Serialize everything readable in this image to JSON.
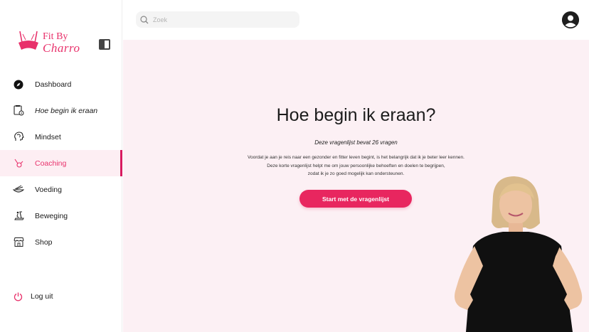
{
  "brand": {
    "line1": "Fit By",
    "line2": "Charro",
    "color": "#e8316b"
  },
  "search": {
    "placeholder": "Zoek",
    "value": ""
  },
  "sidebar": {
    "items": [
      {
        "label": "Dashboard",
        "icon": "compass-icon",
        "active": false
      },
      {
        "label": "Hoe begin ik eraan",
        "icon": "clipboard-info-icon",
        "active": false
      },
      {
        "label": "Mindset",
        "icon": "head-brain-icon",
        "active": false
      },
      {
        "label": "Coaching",
        "icon": "whistle-icon",
        "active": true
      },
      {
        "label": "Voeding",
        "icon": "food-bowl-icon",
        "active": false
      },
      {
        "label": "Beweging",
        "icon": "treadmill-icon",
        "active": false
      },
      {
        "label": "Shop",
        "icon": "store-icon",
        "active": false
      }
    ],
    "logout_label": "Log uit"
  },
  "main": {
    "title": "Hoe begin ik eraan?",
    "subtitle": "Deze vragenlijst bevat 26 vragen",
    "description_lines": [
      "Voordat je aan je reis naar een gezonder en fitter leven begint, is het belangrijk dat ik je beter leer kennen.",
      "Deze korte vragenlijst helpt me om jouw persoonlijke behoeften en doelen te begrijpen,",
      "zodat ik je zo goed mogelijk kan ondersteunen."
    ],
    "cta_label": "Start met de vragenlijst"
  },
  "colors": {
    "accent": "#e8265f",
    "active_bg": "#fdeef3",
    "main_bg": "#fcf0f4"
  }
}
